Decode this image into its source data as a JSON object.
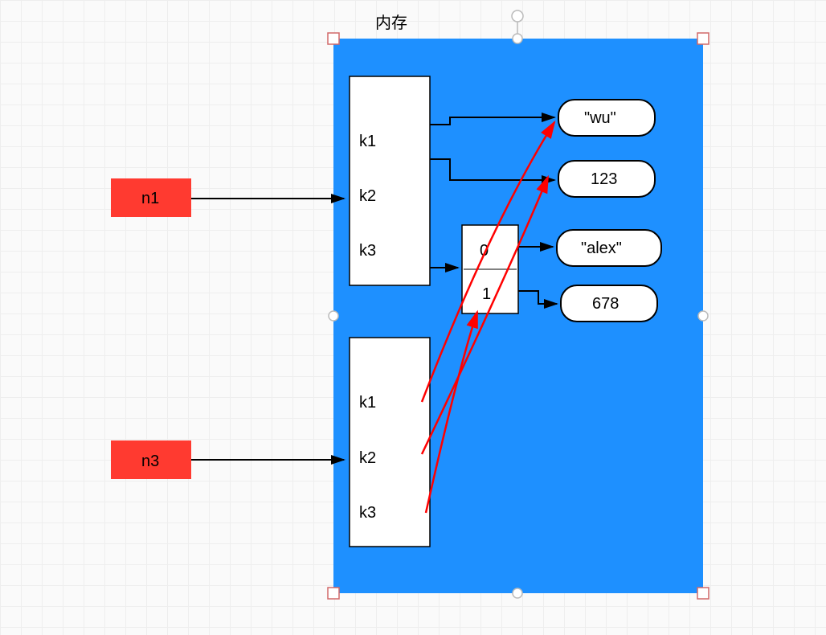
{
  "title": "内存",
  "variables": {
    "n1": "n1",
    "n3": "n3"
  },
  "dict1": {
    "keys": [
      "k1",
      "k2",
      "k3"
    ]
  },
  "dict2": {
    "keys": [
      "k1",
      "k2",
      "k3"
    ]
  },
  "list": {
    "indices": [
      "0",
      "1"
    ]
  },
  "values": {
    "wu": "\"wu\"",
    "v123": "123",
    "alex": "\"alex\"",
    "v678": "678"
  },
  "colors": {
    "memory": "#1e90ff",
    "variable": "#ff3a30",
    "redArrow": "#ff0000"
  }
}
